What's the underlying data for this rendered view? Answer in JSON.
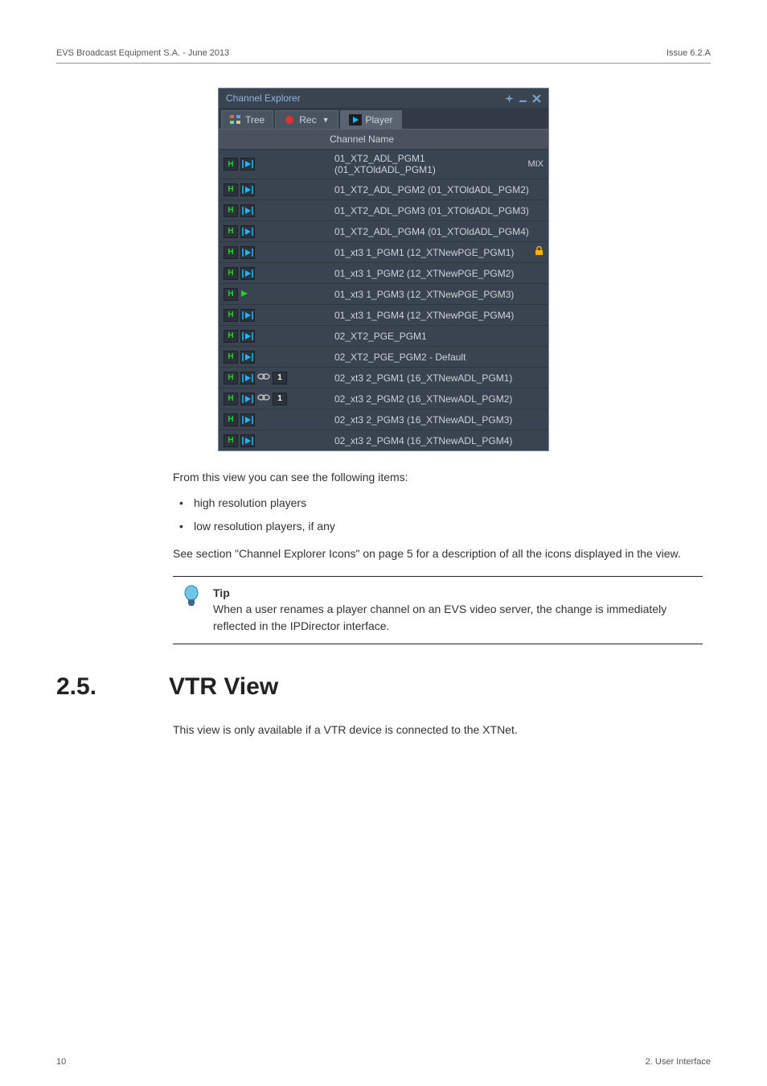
{
  "header": {
    "left": "EVS Broadcast Equipment S.A. - June 2013",
    "right": "Issue 6.2.A"
  },
  "panel": {
    "title": "Channel Explorer",
    "tabs": {
      "tree": "Tree",
      "rec": "Rec",
      "player": "Player"
    },
    "column_header": "Channel Name",
    "rows": [
      {
        "icons": [
          "H",
          "play"
        ],
        "name": "01_XT2_ADL_PGM1 (01_XTOldADL_PGM1)",
        "suffix": "MIX"
      },
      {
        "icons": [
          "H",
          "play"
        ],
        "name": "01_XT2_ADL_PGM2 (01_XTOldADL_PGM2)"
      },
      {
        "icons": [
          "H",
          "play"
        ],
        "name": "01_XT2_ADL_PGM3 (01_XTOldADL_PGM3)"
      },
      {
        "icons": [
          "H",
          "play"
        ],
        "name": "01_XT2_ADL_PGM4 (01_XTOldADL_PGM4)"
      },
      {
        "icons": [
          "H",
          "play"
        ],
        "name": "01_xt3 1_PGM1 (12_XTNewPGE_PGM1)",
        "lock": true
      },
      {
        "icons": [
          "H",
          "play"
        ],
        "name": "01_xt3 1_PGM2 (12_XTNewPGE_PGM2)"
      },
      {
        "icons": [
          "H",
          "tri"
        ],
        "name": "01_xt3 1_PGM3 (12_XTNewPGE_PGM3)"
      },
      {
        "icons": [
          "H",
          "play"
        ],
        "name": "01_xt3 1_PGM4 (12_XTNewPGE_PGM4)"
      },
      {
        "icons": [
          "H",
          "play"
        ],
        "name": "02_XT2_PGE_PGM1"
      },
      {
        "icons": [
          "H",
          "play"
        ],
        "name": "02_XT2_PGE_PGM2 - Default"
      },
      {
        "icons": [
          "H",
          "play",
          "link",
          "one"
        ],
        "name": "02_xt3 2_PGM1 (16_XTNewADL_PGM1)"
      },
      {
        "icons": [
          "H",
          "play",
          "link",
          "one"
        ],
        "name": "02_xt3 2_PGM2 (16_XTNewADL_PGM2)"
      },
      {
        "icons": [
          "H",
          "play"
        ],
        "name": "02_xt3 2_PGM3 (16_XTNewADL_PGM3)"
      },
      {
        "icons": [
          "H",
          "play"
        ],
        "name": "02_xt3 2_PGM4 (16_XTNewADL_PGM4)"
      }
    ]
  },
  "text": {
    "intro": "From this view you can see the following items:",
    "b1": "high resolution players",
    "b2": "low resolution players, if any",
    "see": "See section \"Channel Explorer Icons\" on page 5 for a description of all the icons displayed in the view.",
    "tip_label": "Tip",
    "tip_body": "When a user renames a player channel on an EVS video server, the change is immediately reflected in the IPDirector interface."
  },
  "section": {
    "num": "2.5.",
    "title": "VTR View",
    "body": "This view is only available if a VTR device is connected to the XTNet."
  },
  "footer": {
    "left": "10",
    "right": "2. User Interface"
  }
}
